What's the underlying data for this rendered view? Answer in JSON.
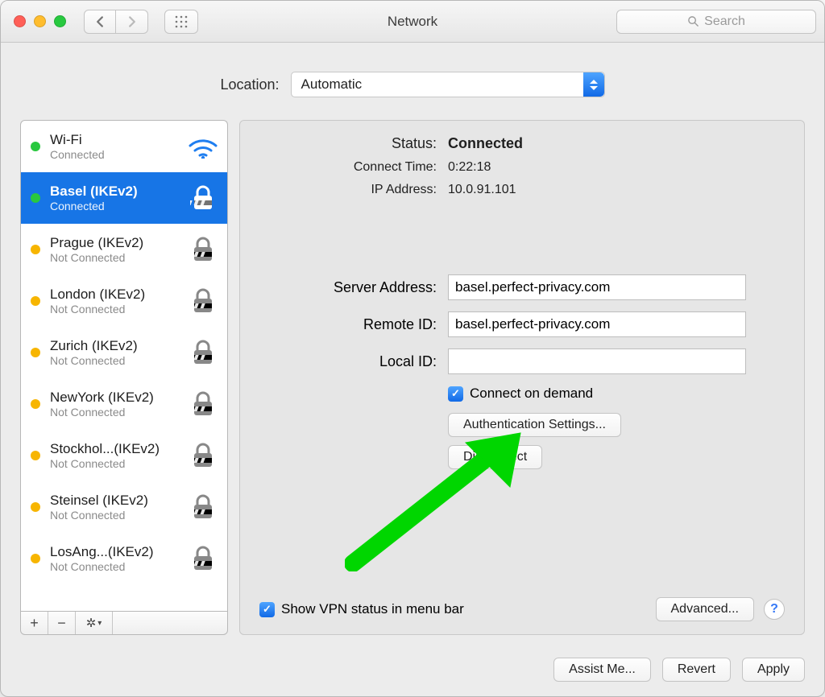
{
  "window_title": "Network",
  "search_placeholder": "Search",
  "location_label": "Location:",
  "location_value": "Automatic",
  "services": [
    {
      "name": "Wi-Fi",
      "status": "Connected",
      "dot": "green",
      "type": "wifi"
    },
    {
      "name": "Basel (IKEv2)",
      "status": "Connected",
      "dot": "green",
      "type": "vpn"
    },
    {
      "name": "Prague (IKEv2)",
      "status": "Not Connected",
      "dot": "amber",
      "type": "vpn"
    },
    {
      "name": "London (IKEv2)",
      "status": "Not Connected",
      "dot": "amber",
      "type": "vpn"
    },
    {
      "name": "Zurich (IKEv2)",
      "status": "Not Connected",
      "dot": "amber",
      "type": "vpn"
    },
    {
      "name": "NewYork (IKEv2)",
      "status": "Not Connected",
      "dot": "amber",
      "type": "vpn"
    },
    {
      "name": "Stockhol...(IKEv2)",
      "status": "Not Connected",
      "dot": "amber",
      "type": "vpn"
    },
    {
      "name": "Steinsel (IKEv2)",
      "status": "Not Connected",
      "dot": "amber",
      "type": "vpn"
    },
    {
      "name": "LosAng...(IKEv2)",
      "status": "Not Connected",
      "dot": "amber",
      "type": "vpn"
    }
  ],
  "selected_service_index": 1,
  "detail": {
    "status_label": "Status:",
    "status_value": "Connected",
    "connect_time_label": "Connect Time:",
    "connect_time_value": "0:22:18",
    "ip_label": "IP Address:",
    "ip_value": "10.0.91.101",
    "server_address_label": "Server Address:",
    "server_address_value": "basel.perfect-privacy.com",
    "remote_id_label": "Remote ID:",
    "remote_id_value": "basel.perfect-privacy.com",
    "local_id_label": "Local ID:",
    "local_id_value": "",
    "connect_on_demand_label": "Connect on demand",
    "connect_on_demand_checked": true,
    "auth_settings_btn": "Authentication Settings...",
    "disconnect_btn": "Disconnect",
    "show_vpn_label": "Show VPN status in menu bar",
    "show_vpn_checked": true,
    "advanced_btn": "Advanced..."
  },
  "buttons": {
    "assist_me": "Assist Me...",
    "revert": "Revert",
    "apply": "Apply"
  },
  "help_glyph": "?"
}
